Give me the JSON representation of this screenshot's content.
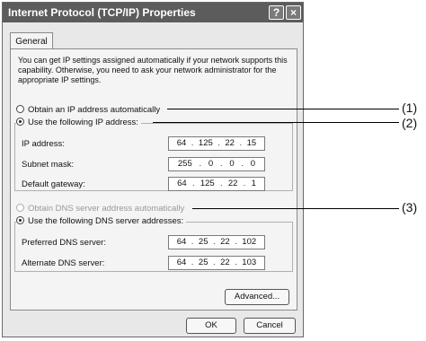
{
  "window": {
    "title": "Internet Protocol (TCP/IP) Properties",
    "help_btn": "?",
    "close_btn": "×"
  },
  "tabs": [
    {
      "label": "General",
      "selected": true
    }
  ],
  "intro_text": "You can get IP settings assigned automatically if your network supports this capability. Otherwise, you need to ask your network administrator for the appropriate IP settings.",
  "ip_options": {
    "auto_label": "Obtain an IP address automatically",
    "manual_label": "Use the following IP address:",
    "selected": "manual"
  },
  "ip_fields": [
    {
      "label": "IP address:",
      "octets": [
        "64",
        "125",
        "22",
        "15"
      ]
    },
    {
      "label": "Subnet mask:",
      "octets": [
        "255",
        "0",
        "0",
        "0"
      ]
    },
    {
      "label": "Default gateway:",
      "octets": [
        "64",
        "125",
        "22",
        "1"
      ]
    }
  ],
  "dns_options": {
    "auto_label": "Obtain DNS server address automatically",
    "manual_label": "Use the following DNS server addresses:",
    "selected": "manual",
    "auto_disabled": true
  },
  "dns_fields": [
    {
      "label": "Preferred DNS server:",
      "octets": [
        "64",
        "25",
        "22",
        "102"
      ]
    },
    {
      "label": "Alternate DNS server:",
      "octets": [
        "64",
        "25",
        "22",
        "103"
      ]
    }
  ],
  "buttons": {
    "advanced": "Advanced...",
    "ok": "OK",
    "cancel": "Cancel"
  },
  "callouts": [
    "(1)",
    "(2)",
    "(3)"
  ]
}
